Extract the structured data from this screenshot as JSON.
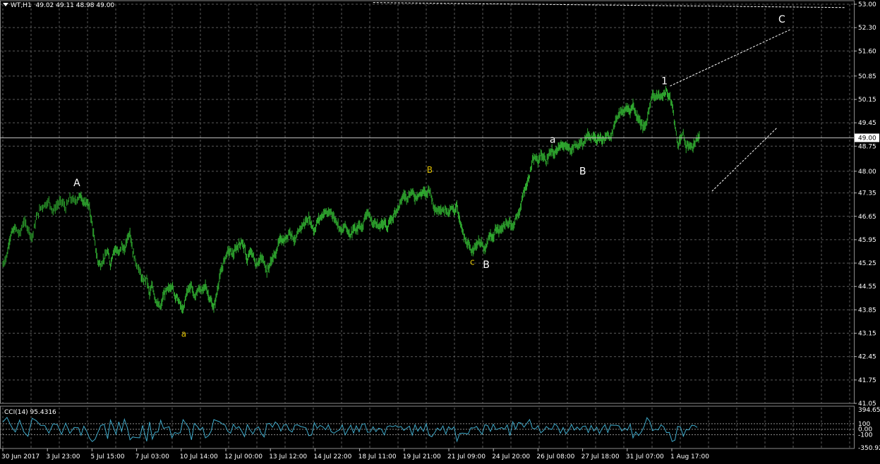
{
  "header": {
    "symbol_period": "WT,H1",
    "ohlc": "49.02 49.11 48.98 49.00"
  },
  "cci_header": "CCI(14) 95.4316",
  "colors": {
    "background": "#000000",
    "grid": "#5a5a5a",
    "candles": "#2fa82f",
    "cci_line": "#3fa9c9",
    "wave_label_primary": "#ffffff",
    "wave_label_secondary": "#e0c000",
    "text": "#ffffff"
  },
  "chart_data": {
    "type": "candlestick",
    "title": "WT,H1",
    "price_axis_ticks": [
      "53.00",
      "52.30",
      "51.60",
      "50.85",
      "50.15",
      "49.45",
      "48.75",
      "48.00",
      "47.35",
      "46.65",
      "45.95",
      "45.25",
      "44.55",
      "43.85",
      "43.15",
      "42.45",
      "41.75",
      "41.05"
    ],
    "current_price_label": "49.00",
    "current_price": 49.0,
    "time_axis_ticks": [
      "30 Jun 2017",
      "3 Jul 23:00",
      "5 Jul 15:00",
      "7 Jul 03:00",
      "10 Jul 14:00",
      "12 Jul 00:00",
      "13 Jul 12:00",
      "14 Jul 22:00",
      "18 Jul 11:00",
      "19 Jul 21:00",
      "21 Jul 09:00",
      "24 Jul 20:00",
      "26 Jul 08:00",
      "27 Jul 18:00",
      "31 Jul 07:00",
      "1 Aug 17:00"
    ],
    "ylim": [
      41.05,
      53.0
    ],
    "close_path": [
      [
        0,
        45.2
      ],
      [
        6,
        45.5
      ],
      [
        10,
        46.0
      ],
      [
        14,
        46.2
      ],
      [
        18,
        46.3
      ],
      [
        24,
        46.1
      ],
      [
        30,
        46.5
      ],
      [
        36,
        46.3
      ],
      [
        42,
        46.0
      ],
      [
        48,
        46.6
      ],
      [
        54,
        46.9
      ],
      [
        60,
        47.0
      ],
      [
        66,
        47.1
      ],
      [
        72,
        46.8
      ],
      [
        78,
        47.0
      ],
      [
        84,
        47.1
      ],
      [
        90,
        46.9
      ],
      [
        96,
        47.2
      ],
      [
        102,
        47.1
      ],
      [
        108,
        47.2
      ],
      [
        112,
        47.3
      ],
      [
        116,
        47.0
      ],
      [
        120,
        47.1
      ],
      [
        124,
        46.9
      ],
      [
        128,
        46.4
      ],
      [
        132,
        45.8
      ],
      [
        136,
        45.3
      ],
      [
        140,
        45.2
      ],
      [
        145,
        45.4
      ],
      [
        150,
        45.6
      ],
      [
        154,
        45.2
      ],
      [
        158,
        45.6
      ],
      [
        162,
        45.7
      ],
      [
        166,
        45.5
      ],
      [
        170,
        45.8
      ],
      [
        174,
        45.6
      ],
      [
        178,
        46.0
      ],
      [
        182,
        46.2
      ],
      [
        186,
        45.6
      ],
      [
        190,
        45.3
      ],
      [
        196,
        45.0
      ],
      [
        200,
        44.7
      ],
      [
        206,
        44.8
      ],
      [
        210,
        44.3
      ],
      [
        214,
        44.6
      ],
      [
        218,
        44.2
      ],
      [
        222,
        44.0
      ],
      [
        226,
        43.9
      ],
      [
        230,
        44.3
      ],
      [
        234,
        44.4
      ],
      [
        238,
        44.5
      ],
      [
        242,
        44.6
      ],
      [
        246,
        44.3
      ],
      [
        250,
        44.2
      ],
      [
        254,
        44.0
      ],
      [
        258,
        43.8
      ],
      [
        262,
        44.3
      ],
      [
        266,
        44.5
      ],
      [
        270,
        44.6
      ],
      [
        274,
        44.2
      ],
      [
        278,
        44.4
      ],
      [
        282,
        44.5
      ],
      [
        286,
        44.4
      ],
      [
        290,
        44.6
      ],
      [
        294,
        44.3
      ],
      [
        298,
        44.1
      ],
      [
        302,
        43.9
      ],
      [
        306,
        44.3
      ],
      [
        310,
        44.8
      ],
      [
        314,
        45.1
      ],
      [
        318,
        45.4
      ],
      [
        322,
        45.6
      ],
      [
        326,
        45.6
      ],
      [
        330,
        45.5
      ],
      [
        334,
        45.7
      ],
      [
        338,
        45.8
      ],
      [
        342,
        45.9
      ],
      [
        346,
        45.7
      ],
      [
        350,
        45.3
      ],
      [
        354,
        45.6
      ],
      [
        358,
        45.5
      ],
      [
        362,
        45.2
      ],
      [
        366,
        45.3
      ],
      [
        370,
        45.4
      ],
      [
        374,
        45.3
      ],
      [
        378,
        45.0
      ],
      [
        382,
        45.2
      ],
      [
        386,
        45.4
      ],
      [
        390,
        45.5
      ],
      [
        394,
        45.8
      ],
      [
        398,
        46.0
      ],
      [
        402,
        45.9
      ],
      [
        406,
        46.0
      ],
      [
        410,
        46.2
      ],
      [
        414,
        46.1
      ],
      [
        418,
        45.9
      ],
      [
        422,
        46.1
      ],
      [
        426,
        46.3
      ],
      [
        430,
        46.4
      ],
      [
        434,
        46.5
      ],
      [
        438,
        46.6
      ],
      [
        442,
        46.4
      ],
      [
        446,
        46.2
      ],
      [
        450,
        46.5
      ],
      [
        454,
        46.6
      ],
      [
        458,
        46.7
      ],
      [
        462,
        46.8
      ],
      [
        466,
        46.7
      ],
      [
        470,
        46.8
      ],
      [
        474,
        46.6
      ],
      [
        478,
        46.5
      ],
      [
        482,
        46.3
      ],
      [
        486,
        46.2
      ],
      [
        490,
        46.4
      ],
      [
        494,
        46.2
      ],
      [
        498,
        46.1
      ],
      [
        502,
        46.3
      ],
      [
        506,
        46.2
      ],
      [
        510,
        46.4
      ],
      [
        514,
        46.3
      ],
      [
        518,
        46.6
      ],
      [
        522,
        46.8
      ],
      [
        526,
        46.6
      ],
      [
        530,
        46.4
      ],
      [
        534,
        46.5
      ],
      [
        538,
        46.3
      ],
      [
        542,
        46.4
      ],
      [
        546,
        46.5
      ],
      [
        550,
        46.3
      ],
      [
        554,
        46.5
      ],
      [
        558,
        46.6
      ],
      [
        562,
        46.8
      ],
      [
        566,
        46.9
      ],
      [
        570,
        47.1
      ],
      [
        574,
        47.3
      ],
      [
        578,
        47.2
      ],
      [
        582,
        47.3
      ],
      [
        586,
        47.4
      ],
      [
        590,
        47.2
      ],
      [
        594,
        47.3
      ],
      [
        598,
        47.3
      ],
      [
        602,
        47.4
      ],
      [
        606,
        47.3
      ],
      [
        610,
        47.5
      ],
      [
        614,
        47.2
      ],
      [
        618,
        46.9
      ],
      [
        622,
        46.8
      ],
      [
        626,
        46.9
      ],
      [
        630,
        46.8
      ],
      [
        634,
        46.9
      ],
      [
        638,
        46.7
      ],
      [
        642,
        46.9
      ],
      [
        646,
        46.8
      ],
      [
        650,
        47.0
      ],
      [
        654,
        46.5
      ],
      [
        658,
        46.2
      ],
      [
        662,
        45.9
      ],
      [
        666,
        45.8
      ],
      [
        670,
        45.6
      ],
      [
        674,
        45.7
      ],
      [
        678,
        45.8
      ],
      [
        682,
        45.9
      ],
      [
        686,
        45.8
      ],
      [
        690,
        45.6
      ],
      [
        694,
        45.9
      ],
      [
        698,
        46.1
      ],
      [
        702,
        46.0
      ],
      [
        706,
        46.3
      ],
      [
        710,
        46.2
      ],
      [
        714,
        46.3
      ],
      [
        718,
        46.4
      ],
      [
        722,
        46.4
      ],
      [
        726,
        46.5
      ],
      [
        730,
        46.3
      ],
      [
        734,
        46.6
      ],
      [
        738,
        46.7
      ],
      [
        742,
        47.0
      ],
      [
        746,
        47.4
      ],
      [
        750,
        47.6
      ],
      [
        754,
        47.9
      ],
      [
        758,
        48.3
      ],
      [
        762,
        48.4
      ],
      [
        766,
        48.3
      ],
      [
        770,
        48.5
      ],
      [
        774,
        48.4
      ],
      [
        778,
        48.3
      ],
      [
        782,
        48.5
      ],
      [
        786,
        48.6
      ],
      [
        790,
        48.5
      ],
      [
        794,
        48.7
      ],
      [
        798,
        48.8
      ],
      [
        802,
        48.7
      ],
      [
        806,
        48.8
      ],
      [
        810,
        48.7
      ],
      [
        814,
        48.6
      ],
      [
        818,
        48.8
      ],
      [
        822,
        48.7
      ],
      [
        826,
        48.9
      ],
      [
        830,
        48.8
      ],
      [
        834,
        49.0
      ],
      [
        838,
        49.1
      ],
      [
        842,
        49.0
      ],
      [
        846,
        49.1
      ],
      [
        850,
        48.9
      ],
      [
        854,
        49.0
      ],
      [
        858,
        48.9
      ],
      [
        862,
        49.0
      ],
      [
        866,
        49.1
      ],
      [
        870,
        49.0
      ],
      [
        874,
        49.3
      ],
      [
        878,
        49.6
      ],
      [
        882,
        49.7
      ],
      [
        886,
        49.8
      ],
      [
        890,
        49.8
      ],
      [
        894,
        49.9
      ],
      [
        898,
        49.8
      ],
      [
        902,
        50.0
      ],
      [
        906,
        49.7
      ],
      [
        910,
        49.6
      ],
      [
        914,
        49.4
      ],
      [
        918,
        49.3
      ],
      [
        922,
        49.5
      ],
      [
        926,
        50.0
      ],
      [
        930,
        50.3
      ],
      [
        934,
        50.2
      ],
      [
        938,
        50.3
      ],
      [
        942,
        50.2
      ],
      [
        946,
        50.3
      ],
      [
        950,
        50.4
      ],
      [
        954,
        50.2
      ],
      [
        958,
        50.0
      ],
      [
        962,
        49.4
      ],
      [
        966,
        48.8
      ],
      [
        970,
        49.0
      ],
      [
        974,
        49.1
      ],
      [
        978,
        48.7
      ],
      [
        982,
        48.8
      ],
      [
        986,
        48.7
      ],
      [
        990,
        48.8
      ],
      [
        994,
        49.0
      ],
      [
        998,
        49.0
      ]
    ],
    "wave_labels": [
      {
        "text": "A",
        "x": 106,
        "price": 47.55,
        "color": "primary"
      },
      {
        "text": "a",
        "x": 259,
        "price": 43.05,
        "color": "secondary"
      },
      {
        "text": "B",
        "x": 611,
        "price": 47.95,
        "color": "secondary"
      },
      {
        "text": "c",
        "x": 672,
        "price": 45.2,
        "color": "secondary"
      },
      {
        "text": "B",
        "x": 692,
        "price": 45.1,
        "color": "primary"
      },
      {
        "text": "a",
        "x": 787,
        "price": 48.85,
        "color": "primary"
      },
      {
        "text": "B",
        "x": 830,
        "price": 47.9,
        "color": "primary"
      },
      {
        "text": "1",
        "x": 947,
        "price": 50.6,
        "color": "primary"
      },
      {
        "text": "C",
        "x": 1115,
        "price": 52.45,
        "color": "primary"
      }
    ],
    "trend_lines": [
      {
        "from": [
          955,
          50.55
        ],
        "to": [
          1128,
          52.25
        ]
      },
      {
        "from": [
          1015,
          47.4
        ],
        "to": [
          1108,
          49.3
        ]
      },
      {
        "from": [
          530,
          53.05
        ],
        "to": [
          1205,
          52.9
        ]
      }
    ],
    "cci": {
      "name": "CCI(14)",
      "last_value": 95.4316,
      "axis_ticks": [
        "394.6594",
        "100",
        "0.00",
        "-100",
        "-350.925"
      ],
      "range": [
        -350.925,
        394.6594
      ]
    }
  }
}
